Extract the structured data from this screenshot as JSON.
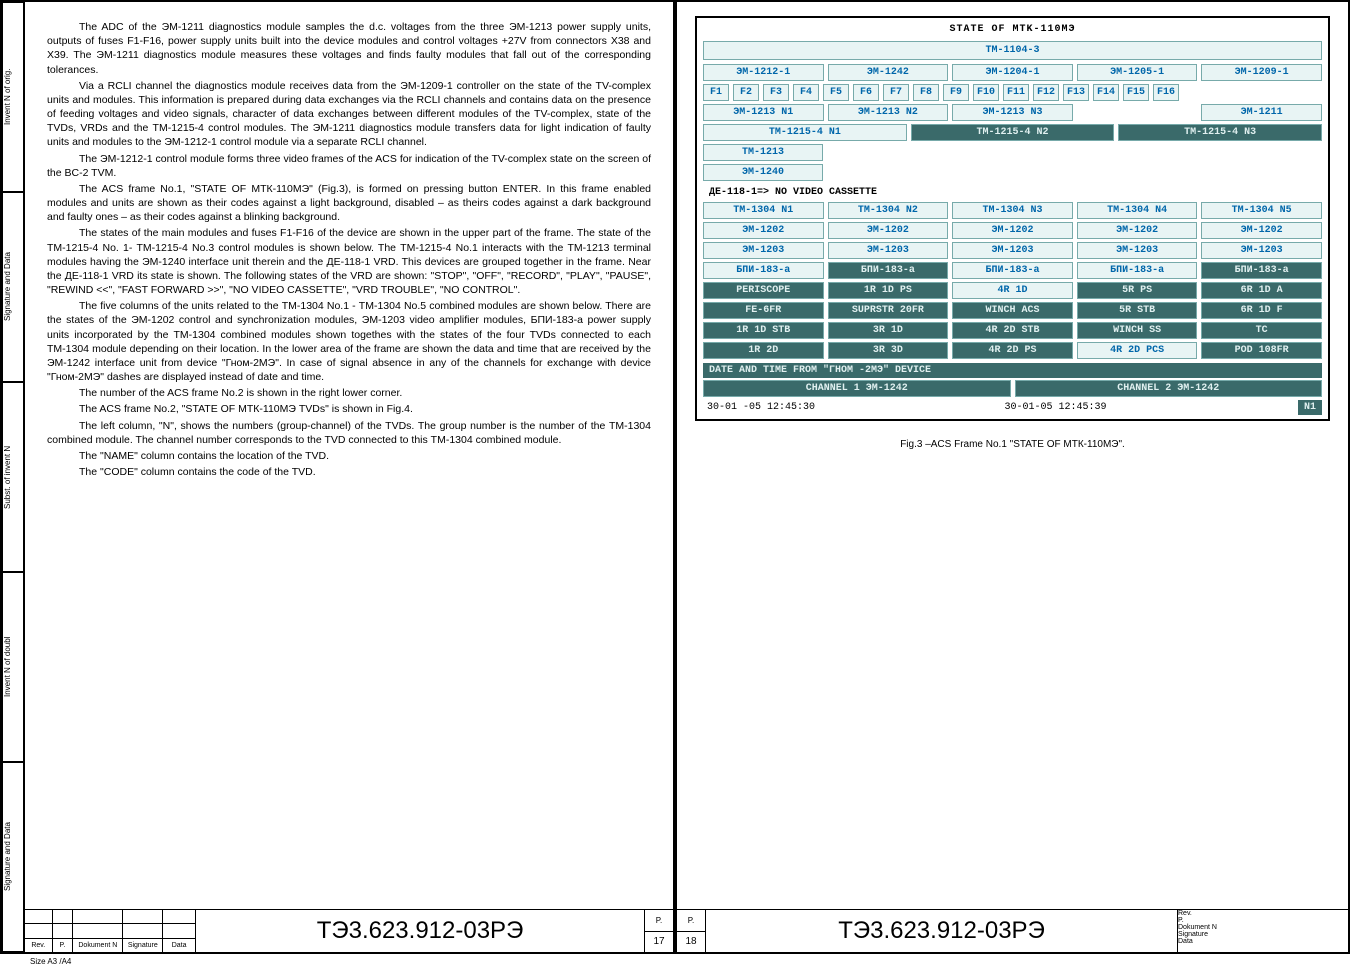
{
  "left": {
    "paragraphs": [
      "The ADC of the ЭМ-1211 diagnostics module samples the d.c. voltages from the three ЭМ-1213 power supply units, outputs of fuses F1-F16, power supply units built into the device modules and control voltages +27V from connectors X38 and X39. The ЭМ-1211 diagnostics module measures these voltages and finds faulty modules that fall out of the corresponding tolerances.",
      "Via a RCLI channel the diagnostics module receives data from the ЭМ-1209-1 controller on the state of the TV-complex units and modules. This information is prepared during data exchanges via the RCLI channels and contains data on the presence of feeding voltages and video signals, character of data exchanges between different modules of the TV-complex, state of the TVDs, VRDs and the ТМ-1215-4 control modules. The ЭМ-1211 diagnostics module transfers data for light indication of faulty units and modules to the ЭМ-1212-1 control module via a separate RCLI channel.",
      "The ЭМ-1212-1 control module forms three video frames of the ACS for indication of the TV-complex state on the screen of the BC-2 TVM.",
      "The ACS frame No.1, \"STATE OF МТК-110МЭ\" (Fig.3), is formed on pressing button ENTER. In this frame enabled modules and units are shown as their codes against a light background, disabled – as theirs codes against a dark background and faulty ones – as their codes against a blinking background.",
      "The states of the main modules and fuses F1-F16 of the device are shown in the upper part of the frame. The state of the ТМ-1215-4 No. 1- ТМ-1215-4 No.3 control modules is shown below. The ТМ-1215-4 No.1 interacts with the ТМ-1213 terminal modules having the ЭМ-1240 interface unit therein and the ДЕ-118-1 VRD. This devices are grouped together in the frame. Near the ДЕ-118-1 VRD its state is shown. The following states of the VRD are shown: \"STOP\", \"OFF\", \"RECORD\", \"PLAY\", \"PAUSE\", \"REWIND <<\", \"FAST FORWARD >>\", \"NO VIDEO CASSETTE\", \"VRD TROUBLE\", \"NO CONTROL\".",
      "The five columns of the units related to the ТМ-1304 No.1 - ТМ-1304 No.5 combined modules are shown below. There are the states of the ЭМ-1202 control and synchronization modules, ЭМ-1203 video amplifier modules, БПИ-183-a power supply units incorporated by the ТМ-1304 combined modules shown togethes with the states of the four TVDs connected to each ТМ-1304 module depending on their location. In the lower area of the frame are shown the data and time that are received by the ЭМ-1242 interface unit from device \"Гном-2МЭ\". In case of signal absence in any of the channels for exchange with device \"Гном-2МЭ\" dashes are displayed instead of date and time.",
      "The number of the ACS frame No.2 is shown in the right lower corner.",
      "The ACS frame No.2, \"STATE OF МТК-110МЭ TVDs\" is shown in Fig.4.",
      "The left column, \"N\", shows the numbers (group-channel) of the TVDs. The group number is the number of the ТМ-1304 combined module. The channel number corresponds to the TVD connected to this ТМ-1304 combined module.",
      "The \"NAME\" column contains the location of the TVD.",
      "The \"CODE\" column contains the code of the TVD."
    ],
    "side_tabs": [
      "Invent N of orig.",
      "Signature and Data",
      "Subst. of invent N",
      "Invent N of doubl",
      "Signature and Data"
    ],
    "title_block": {
      "headers": [
        "Rev.",
        "P.",
        "Dokument N",
        "Signature",
        "Data"
      ],
      "docnum": "ТЭ3.623.912-03РЭ",
      "p_label": "P.",
      "page": "17"
    },
    "size_note": "Size A3 /A4"
  },
  "screen": {
    "title": "STATE OF MTK-110МЭ",
    "subtitle": "ТМ-1104-3",
    "row1": [
      "ЭМ-1212-1",
      "ЭМ-1242",
      "ЭМ-1204-1",
      "ЭМ-1205-1",
      "ЭМ-1209-1"
    ],
    "fuses": [
      "F1",
      "F2",
      "F3",
      "F4",
      "F5",
      "F6",
      "F7",
      "F8",
      "F9",
      "F10",
      "F11",
      "F12",
      "F13",
      "F14",
      "F15",
      "F16"
    ],
    "row3": [
      "ЭМ-1213 N1",
      "ЭМ-1213 N2",
      "ЭМ-1213 N3",
      "",
      "ЭМ-1211"
    ],
    "row4": [
      {
        "t": "TM-1215-4 N1",
        "d": false
      },
      {
        "t": "TM-1215-4 N2",
        "d": true
      },
      {
        "t": "TM-1215-4 N3",
        "d": true
      }
    ],
    "row5": "TM-1213",
    "row6": "ЭМ-1240",
    "de": "ДЕ-118-1=>   NO VIDEO CASSETTE",
    "grid_header": [
      "TM-1304 N1",
      "TM-1304 N2",
      "TM-1304 N3",
      "TM-1304 N4",
      "TM-1304 N5"
    ],
    "grid": [
      [
        {
          "t": "ЭМ-1202"
        },
        {
          "t": "ЭМ-1202"
        },
        {
          "t": "ЭМ-1202"
        },
        {
          "t": "ЭМ-1202"
        },
        {
          "t": "ЭМ-1202"
        }
      ],
      [
        {
          "t": "ЭМ-1203"
        },
        {
          "t": "ЭМ-1203"
        },
        {
          "t": "ЭМ-1203"
        },
        {
          "t": "ЭМ-1203"
        },
        {
          "t": "ЭМ-1203"
        }
      ],
      [
        {
          "t": "БПИ-183-а"
        },
        {
          "t": "БПИ-183-а",
          "d": true
        },
        {
          "t": "БПИ-183-а"
        },
        {
          "t": "БПИ-183-а"
        },
        {
          "t": "БПИ-183-а",
          "d": true
        }
      ],
      [
        {
          "t": "PERISCOPE",
          "d": true
        },
        {
          "t": "1R 1D PS",
          "d": true
        },
        {
          "t": "4R 1D"
        },
        {
          "t": "5R PS",
          "d": true
        },
        {
          "t": "6R 1D A",
          "d": true
        }
      ],
      [
        {
          "t": "FE-6FR",
          "d": true
        },
        {
          "t": "SUPRSTR 20FR",
          "d": true
        },
        {
          "t": "WINCH ACS",
          "d": true
        },
        {
          "t": "5R STB",
          "d": true
        },
        {
          "t": "6R 1D F",
          "d": true
        }
      ],
      [
        {
          "t": "1R 1D STB",
          "d": true
        },
        {
          "t": "3R 1D",
          "d": true
        },
        {
          "t": "4R 2D STB",
          "d": true
        },
        {
          "t": "WINCH SS",
          "d": true
        },
        {
          "t": "TC",
          "d": true
        }
      ],
      [
        {
          "t": "1R 2D",
          "d": true
        },
        {
          "t": "3R 3D",
          "d": true
        },
        {
          "t": "4R 2D PS",
          "d": true
        },
        {
          "t": "4R 2D PCS"
        },
        {
          "t": "POD 108FR",
          "d": true
        }
      ]
    ],
    "date_header": "DATE AND TIME FROM \"ГНОМ -2МЭ\" DEVICE",
    "channels": [
      "CHANNEL 1 ЭМ-1242",
      "CHANNEL 2 ЭМ-1242"
    ],
    "datetime_left": "30-01 -05   12:45:30",
    "datetime_right": "30-01-05   12:45:39",
    "n1": "N1"
  },
  "caption": "Fig.3 –ACS Frame No.1 \"STATE OF МТК-110МЭ\".",
  "right": {
    "title_block": {
      "p_label": "P.",
      "page": "18",
      "docnum": "ТЭ3.623.912-03РЭ",
      "headers": [
        "Rev.",
        "P.",
        "Dokument N",
        "Signature",
        "Data"
      ]
    }
  }
}
